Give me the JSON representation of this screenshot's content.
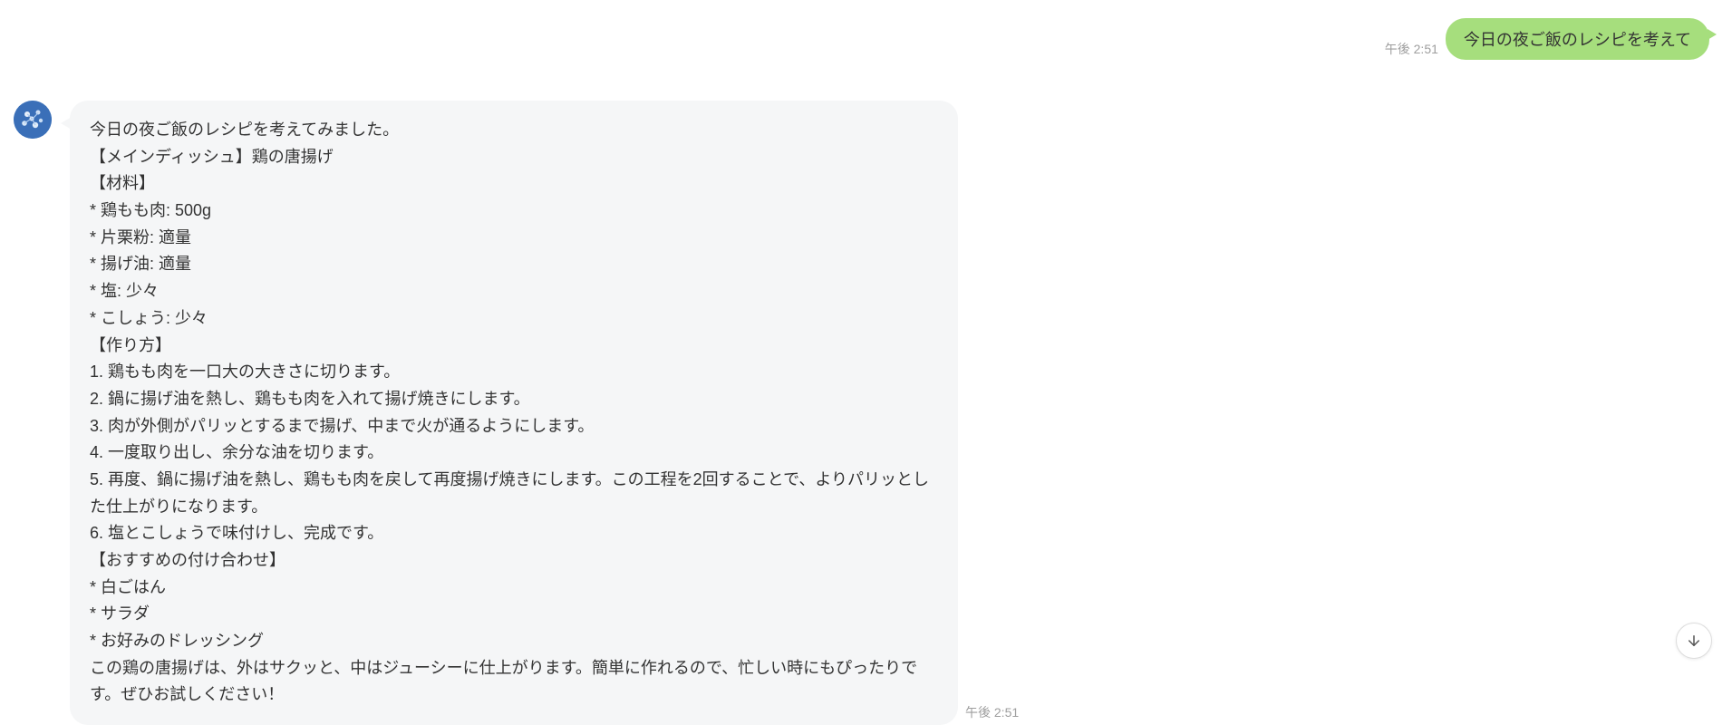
{
  "user_message": {
    "text": "今日の夜ご飯のレシピを考えて",
    "timestamp": "午後 2:51"
  },
  "bot_message": {
    "timestamp": "午後 2:51",
    "lines": [
      "今日の夜ご飯のレシピを考えてみました。",
      "【メインディッシュ】鶏の唐揚げ",
      "【材料】",
      "* 鶏もも肉: 500g",
      "* 片栗粉: 適量",
      "* 揚げ油: 適量",
      "* 塩: 少々",
      "* こしょう: 少々",
      "【作り方】",
      "1. 鶏もも肉を一口大の大きさに切ります。",
      "2. 鍋に揚げ油を熱し、鶏もも肉を入れて揚げ焼きにします。",
      "3. 肉が外側がパリッとするまで揚げ、中まで火が通るようにします。",
      "4. 一度取り出し、余分な油を切ります。",
      "5. 再度、鍋に揚げ油を熱し、鶏もも肉を戻して再度揚げ焼きにします。この工程を2回することで、よりパリッとした仕上がりになります。",
      "6. 塩とこしょうで味付けし、完成です。",
      "【おすすめの付け合わせ】",
      "* 白ごはん",
      "* サラダ",
      "* お好みのドレッシング",
      "この鶏の唐揚げは、外はサクッと、中はジューシーに仕上がります。簡単に作れるので、忙しい時にもぴったりです。ぜひお試しください！"
    ]
  }
}
